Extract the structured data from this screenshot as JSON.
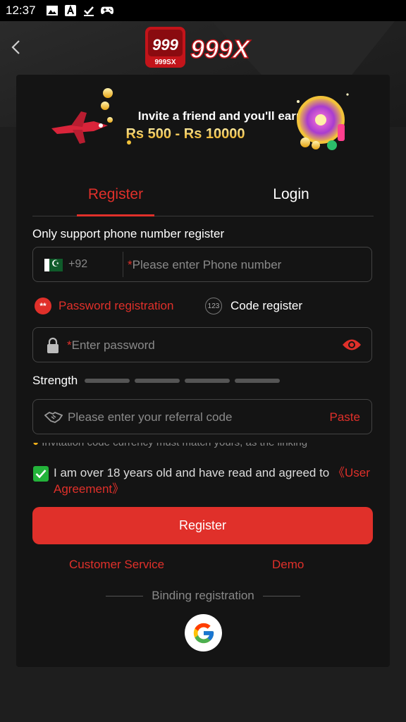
{
  "status_bar": {
    "time": "12:37",
    "icons": [
      "image-icon",
      "app-icon",
      "check-icon",
      "gamepad-icon"
    ]
  },
  "header": {
    "back_icon": "chevron-left-icon",
    "logo_badge_text": "999",
    "logo_badge_sub": "999SX",
    "logo_text": "999X"
  },
  "banner": {
    "line1": "Invite a friend and you'll earn",
    "line2": "Rs 500 - Rs 10000"
  },
  "tabs": [
    {
      "label": "Register",
      "active": true
    },
    {
      "label": "Login",
      "active": false
    }
  ],
  "form": {
    "phone_section_label": "Only support phone number register",
    "country_code": "+92",
    "phone_required_mark": "*",
    "phone_placeholder": "Please enter Phone number",
    "option_password": "Password registration",
    "option_password_badge": "**",
    "option_code": "Code register",
    "option_code_badge": "123",
    "password_required_mark": "*",
    "password_placeholder": "Enter password",
    "strength_label": "Strength",
    "strength_level": 0,
    "referral_placeholder": "Please enter your referral code",
    "paste_label": "Paste",
    "notice_text": "Invitation code currency must match yours, as the linking",
    "agreement_checked": true,
    "agreement_text": "I am over 18 years old and have read and agreed to",
    "agreement_link": "《User Agreement》",
    "register_button": "Register",
    "customer_service": "Customer Service",
    "demo": "Demo",
    "binding_label": "Binding registration"
  },
  "colors": {
    "accent": "#e0302a",
    "background": "#1e1e1e",
    "card": "#141414",
    "check": "#23b33a"
  }
}
